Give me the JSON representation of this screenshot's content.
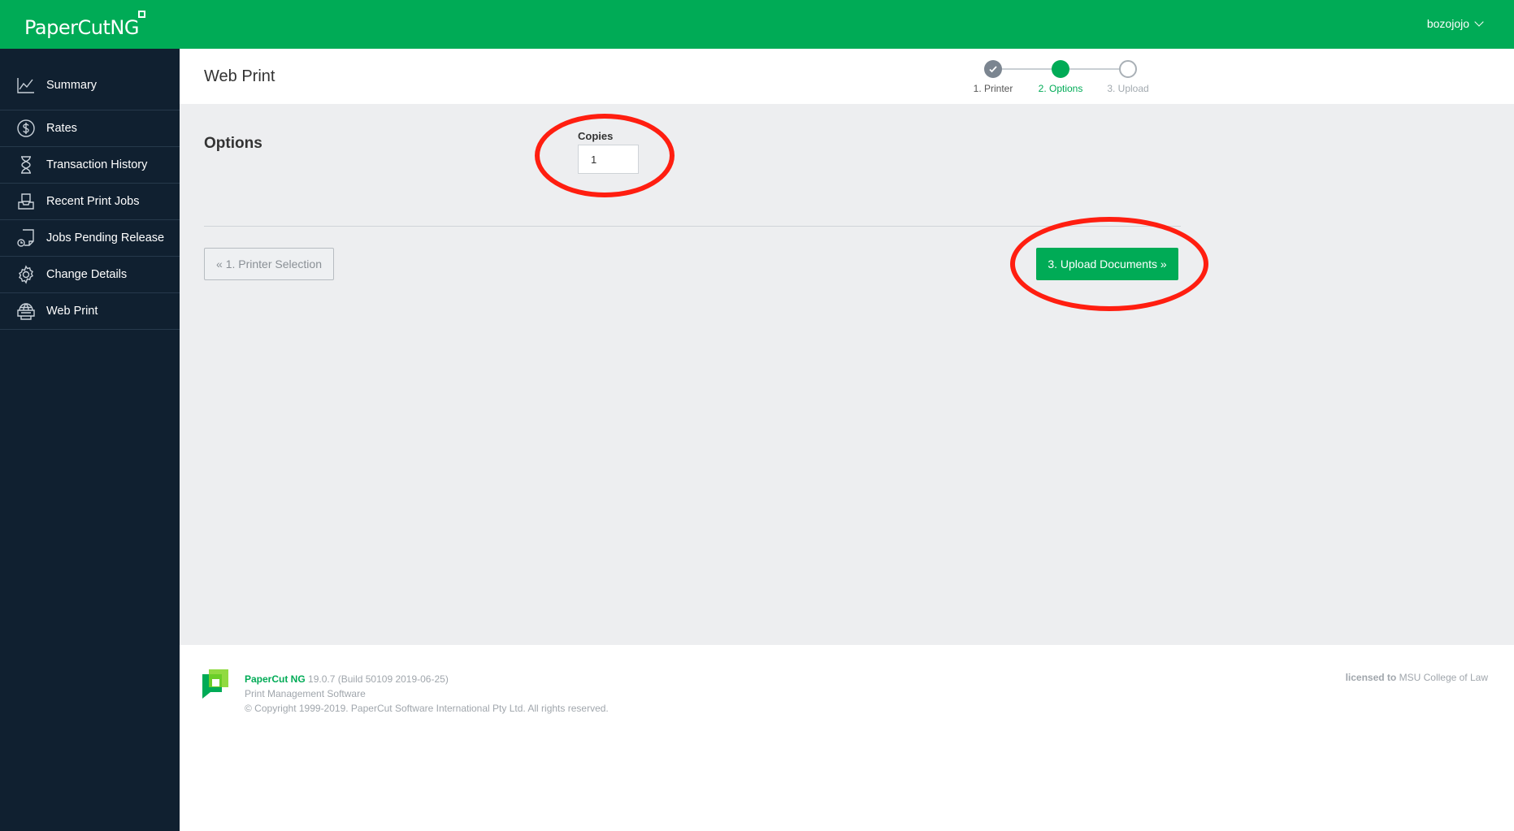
{
  "app": {
    "logo_text": "PaperCut",
    "logo_suffix": "NG",
    "user": "bozojojo"
  },
  "sidebar": {
    "items": [
      {
        "label": "Summary",
        "icon": "chart-line-icon"
      },
      {
        "label": "Rates",
        "icon": "dollar-circle-icon"
      },
      {
        "label": "Transaction History",
        "icon": "hourglass-icon"
      },
      {
        "label": "Recent Print Jobs",
        "icon": "tray-icon"
      },
      {
        "label": "Jobs Pending Release",
        "icon": "document-clock-icon"
      },
      {
        "label": "Change Details",
        "icon": "gear-icon"
      },
      {
        "label": "Web Print",
        "icon": "globe-printer-icon"
      }
    ]
  },
  "header": {
    "title": "Web Print"
  },
  "stepper": {
    "steps": [
      {
        "label": "1. Printer",
        "state": "done"
      },
      {
        "label": "2. Options",
        "state": "active"
      },
      {
        "label": "3. Upload",
        "state": "pending"
      }
    ]
  },
  "options": {
    "section_title": "Options",
    "copies_label": "Copies",
    "copies_value": "1"
  },
  "buttons": {
    "back_label": "« 1. Printer Selection",
    "next_label": "3. Upload Documents »"
  },
  "footer": {
    "brand": "PaperCut NG",
    "version": "19.0.7 (Build 50109 2019-06-25)",
    "tagline": "Print Management Software",
    "copyright": "© Copyright 1999-2019. PaperCut Software International Pty Ltd. All rights reserved.",
    "licensed_prefix": "licensed to",
    "licensee": "MSU College of Law"
  },
  "colors": {
    "brand_green": "#00ab56",
    "sidebar_bg": "#102030",
    "annotation_red": "#ff1e10"
  }
}
